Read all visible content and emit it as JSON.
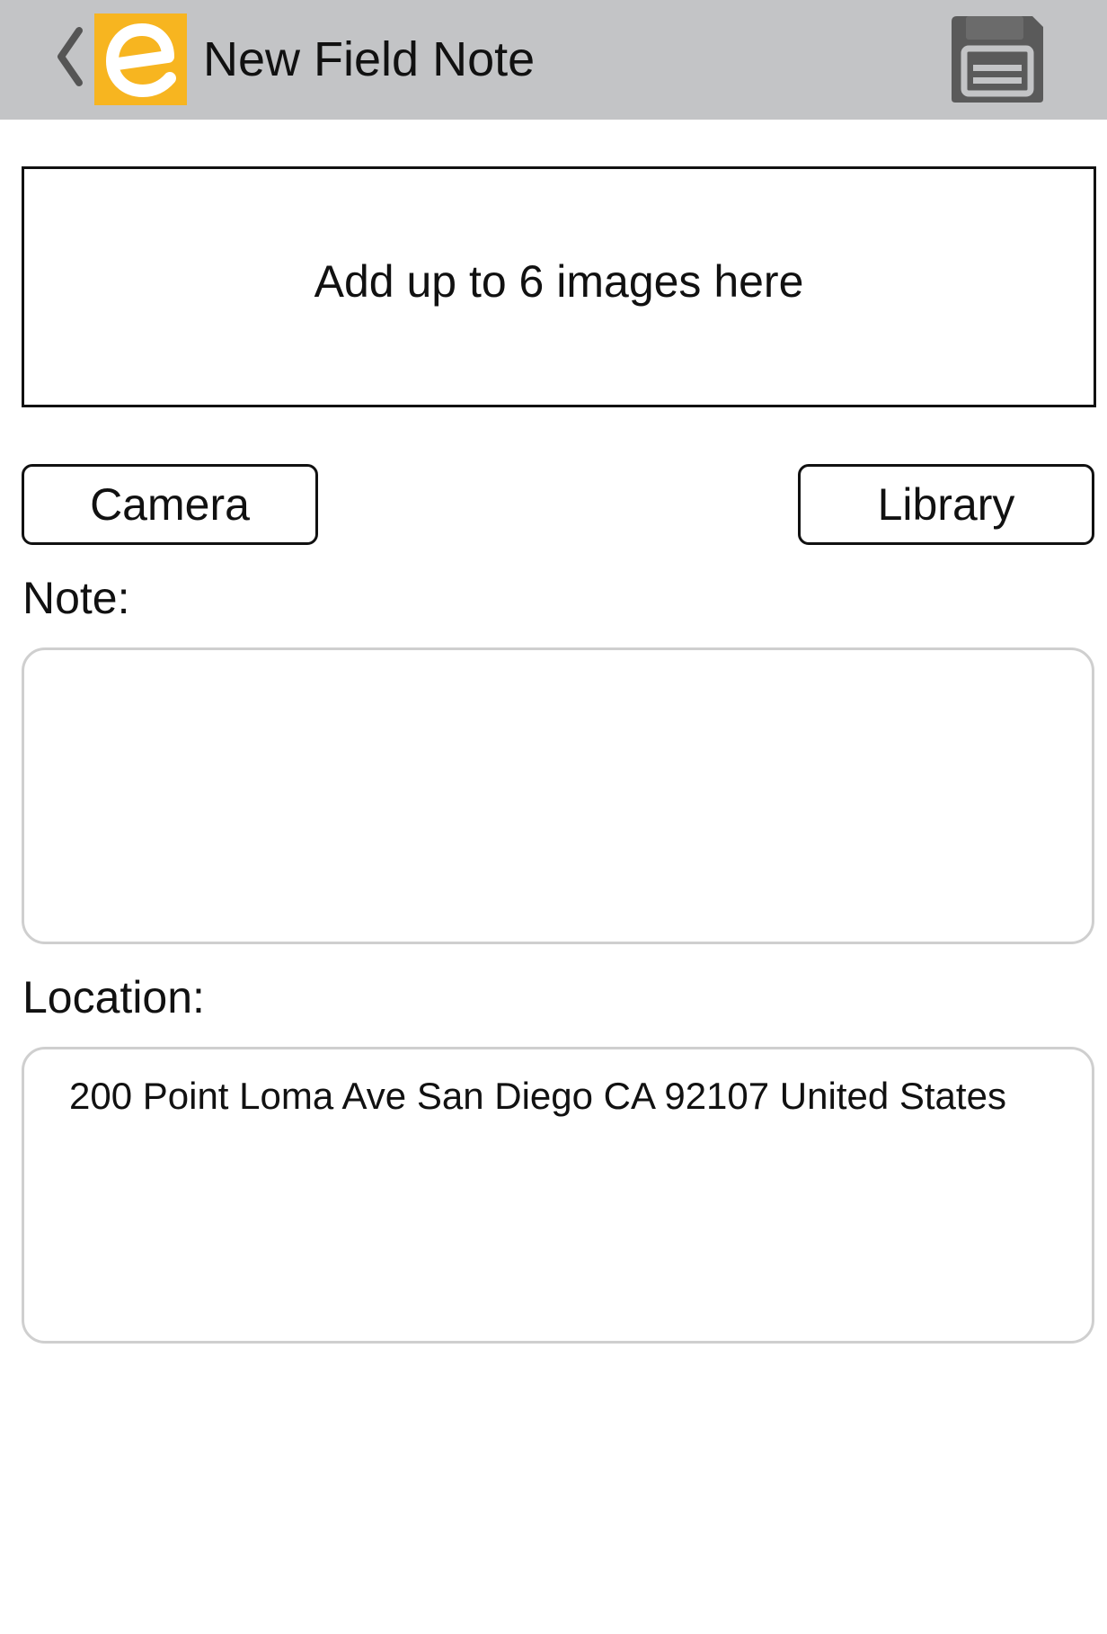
{
  "header": {
    "title": "New Field Note",
    "background": "#c3c4c6",
    "logo_color": "#f7b520",
    "back_icon": "chevron-left-icon",
    "save_icon": "floppy-disk-icon"
  },
  "images": {
    "drop_label": "Add up to 6 images here"
  },
  "buttons": {
    "camera": "Camera",
    "library": "Library"
  },
  "note": {
    "label": "Note:",
    "value": ""
  },
  "location": {
    "label": "Location:",
    "value": "200 Point Loma Ave San Diego CA 92107 United States"
  }
}
